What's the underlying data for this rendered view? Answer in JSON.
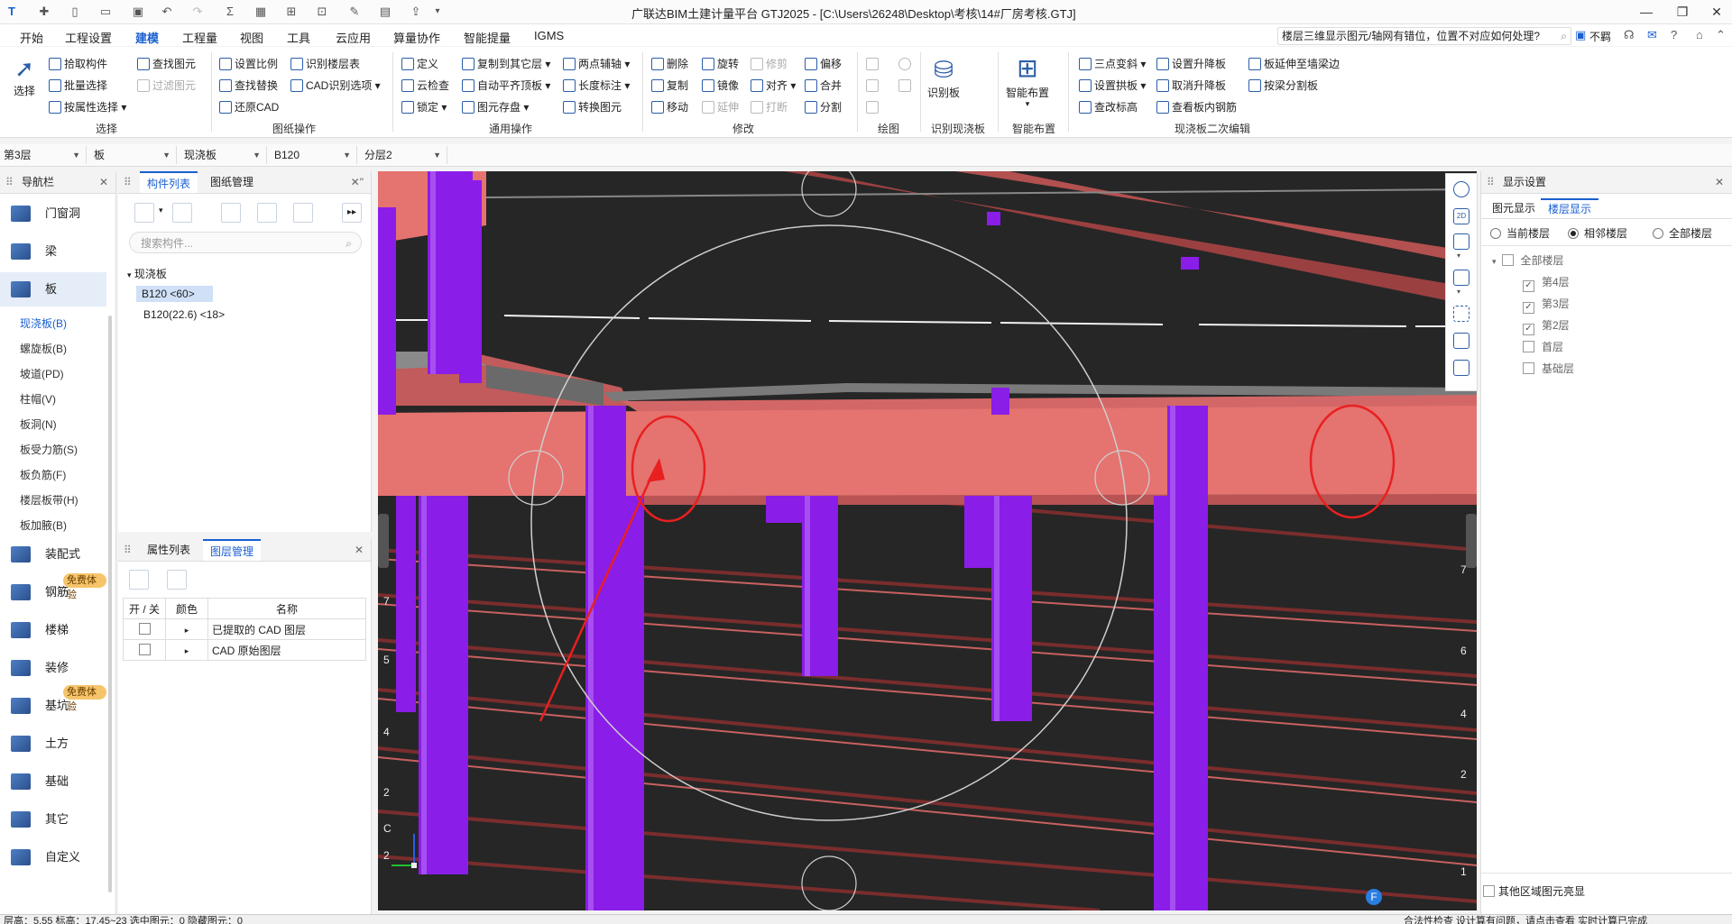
{
  "titlebar": {
    "title": "广联达BIM土建计量平台 GTJ2025 - [C:\\Users\\26248\\Desktop\\考核\\14#厂房考核.GTJ]",
    "minimize": "—",
    "maximize": "❐",
    "close": "✕"
  },
  "menu": {
    "items": [
      "开始",
      "工程设置",
      "建模",
      "工程量",
      "视图",
      "工具",
      "云应用",
      "算量协作",
      "智能提量",
      "IGMS"
    ],
    "active": "建模",
    "help_text": "楼层三维显示图元/轴网有错位，位置不对应如何处理?",
    "user": "不羁"
  },
  "ribbon": {
    "select": {
      "big": "选择",
      "items": [
        "拾取构件",
        "批量选择",
        "按属性选择"
      ],
      "group": "选择"
    },
    "find": {
      "items": [
        "查找图元",
        "过滤图元"
      ]
    },
    "drawing_ops": {
      "items": [
        "设置比例",
        "查找替换",
        "还原CAD",
        "识别楼层表",
        "CAD识别选项"
      ],
      "group": "图纸操作"
    },
    "general": {
      "items": [
        "定义",
        "云检查",
        "锁定",
        "复制到其它层",
        "自动平齐顶板",
        "图元存盘",
        "两点辅轴",
        "长度标注",
        "转换图元"
      ],
      "group": "通用操作"
    },
    "modify": {
      "items": [
        "删除",
        "旋转",
        "修剪",
        "偏移",
        "复制",
        "镜像",
        "对齐",
        "合并",
        "移动",
        "延伸",
        "打断",
        "分割"
      ],
      "group": "修改"
    },
    "draw": {
      "group": "绘图"
    },
    "recognize": {
      "big": "识别板",
      "group": "识别现浇板"
    },
    "smart": {
      "big": "智能布置",
      "group": "智能布置"
    },
    "edit2": {
      "items": [
        "三点变斜",
        "设置升降板",
        "板延伸至墙梁边",
        "设置拱板",
        "取消升降板",
        "按梁分割板",
        "查改标高",
        "查看板内钢筋"
      ],
      "group": "现浇板二次编辑"
    }
  },
  "selectors": [
    "第3层",
    "板",
    "现浇板",
    "B120",
    "分层2"
  ],
  "nav": {
    "title": "导航栏",
    "items": [
      "门窗洞",
      "梁",
      "板",
      "装配式",
      "钢筋",
      "楼梯",
      "装修",
      "基坑",
      "土方",
      "基础",
      "其它",
      "自定义"
    ],
    "selected": "板",
    "sub_items": [
      "现浇板(B)",
      "螺旋板(B)",
      "坡道(PD)",
      "柱帽(V)",
      "板洞(N)",
      "板受力筋(S)",
      "板负筋(F)",
      "楼层板带(H)",
      "板加腋(B)"
    ],
    "sub_selected": "现浇板(B)",
    "badge": "免费体验"
  },
  "components": {
    "tabs": [
      "构件列表",
      "图纸管理"
    ],
    "search_placeholder": "搜索构件...",
    "tree_root": "现浇板",
    "items": [
      "B120 <60>",
      "B120(22.6) <18>"
    ]
  },
  "layers": {
    "tabs": [
      "属性列表",
      "图层管理"
    ],
    "headers": [
      "开 / 关",
      "颜色",
      "名称"
    ],
    "rows": [
      "已提取的 CAD 图层",
      "CAD 原始图层"
    ]
  },
  "display": {
    "title": "显示设置",
    "tabs": [
      "图元显示",
      "楼层显示"
    ],
    "radios": [
      "当前楼层",
      "相邻楼层",
      "全部楼层"
    ],
    "radio_selected": "相邻楼层",
    "tree_root": "全部楼层",
    "floors": [
      {
        "name": "第4层",
        "checked": true
      },
      {
        "name": "第3层",
        "checked": true
      },
      {
        "name": "第2层",
        "checked": true
      },
      {
        "name": "首层",
        "checked": false
      },
      {
        "name": "基础层",
        "checked": false
      }
    ],
    "footer": "其他区域图元亮显"
  },
  "viewport": {
    "axis_labels_right": [
      "7",
      "6",
      "4",
      "2",
      "1"
    ],
    "axis_labels_left": [
      "7",
      "5",
      "4",
      "2",
      "C",
      "2"
    ],
    "bottom_label": "F",
    "colors": {
      "bg": "#262626",
      "column": "#8a1de8",
      "slab": "#e57370",
      "beam": "#8f3b3b",
      "annotation": "#e82020"
    }
  },
  "status": {
    "left": "层高：5.55    标高：17.45~23   选中图元：0    隐藏图元：0",
    "right": "合法性检查 设计算有问题，请点击查看   实时计算已完成"
  }
}
